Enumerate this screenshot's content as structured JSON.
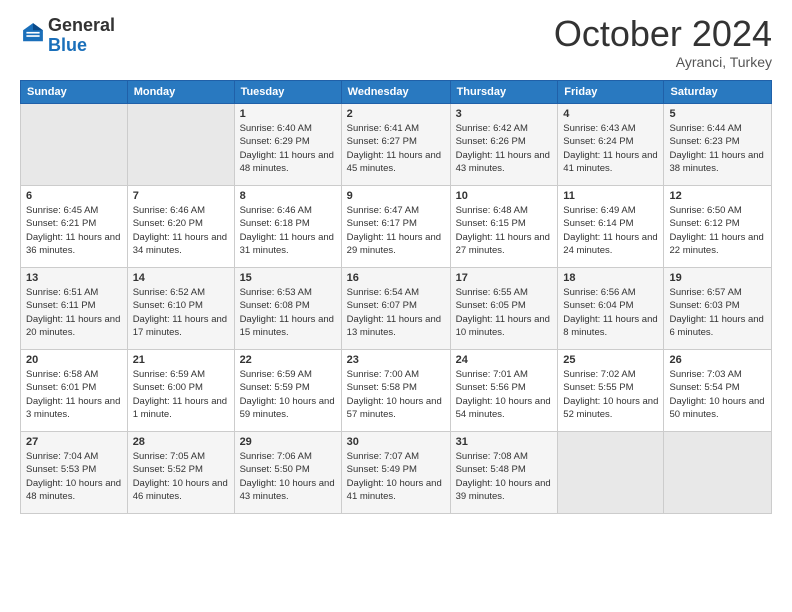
{
  "logo": {
    "general": "General",
    "blue": "Blue"
  },
  "title": {
    "month": "October 2024",
    "location": "Ayranci, Turkey"
  },
  "days_of_week": [
    "Sunday",
    "Monday",
    "Tuesday",
    "Wednesday",
    "Thursday",
    "Friday",
    "Saturday"
  ],
  "weeks": [
    [
      {
        "day": "",
        "detail": ""
      },
      {
        "day": "",
        "detail": ""
      },
      {
        "day": "1",
        "detail": "Sunrise: 6:40 AM\nSunset: 6:29 PM\nDaylight: 11 hours and 48 minutes."
      },
      {
        "day": "2",
        "detail": "Sunrise: 6:41 AM\nSunset: 6:27 PM\nDaylight: 11 hours and 45 minutes."
      },
      {
        "day": "3",
        "detail": "Sunrise: 6:42 AM\nSunset: 6:26 PM\nDaylight: 11 hours and 43 minutes."
      },
      {
        "day": "4",
        "detail": "Sunrise: 6:43 AM\nSunset: 6:24 PM\nDaylight: 11 hours and 41 minutes."
      },
      {
        "day": "5",
        "detail": "Sunrise: 6:44 AM\nSunset: 6:23 PM\nDaylight: 11 hours and 38 minutes."
      }
    ],
    [
      {
        "day": "6",
        "detail": "Sunrise: 6:45 AM\nSunset: 6:21 PM\nDaylight: 11 hours and 36 minutes."
      },
      {
        "day": "7",
        "detail": "Sunrise: 6:46 AM\nSunset: 6:20 PM\nDaylight: 11 hours and 34 minutes."
      },
      {
        "day": "8",
        "detail": "Sunrise: 6:46 AM\nSunset: 6:18 PM\nDaylight: 11 hours and 31 minutes."
      },
      {
        "day": "9",
        "detail": "Sunrise: 6:47 AM\nSunset: 6:17 PM\nDaylight: 11 hours and 29 minutes."
      },
      {
        "day": "10",
        "detail": "Sunrise: 6:48 AM\nSunset: 6:15 PM\nDaylight: 11 hours and 27 minutes."
      },
      {
        "day": "11",
        "detail": "Sunrise: 6:49 AM\nSunset: 6:14 PM\nDaylight: 11 hours and 24 minutes."
      },
      {
        "day": "12",
        "detail": "Sunrise: 6:50 AM\nSunset: 6:12 PM\nDaylight: 11 hours and 22 minutes."
      }
    ],
    [
      {
        "day": "13",
        "detail": "Sunrise: 6:51 AM\nSunset: 6:11 PM\nDaylight: 11 hours and 20 minutes."
      },
      {
        "day": "14",
        "detail": "Sunrise: 6:52 AM\nSunset: 6:10 PM\nDaylight: 11 hours and 17 minutes."
      },
      {
        "day": "15",
        "detail": "Sunrise: 6:53 AM\nSunset: 6:08 PM\nDaylight: 11 hours and 15 minutes."
      },
      {
        "day": "16",
        "detail": "Sunrise: 6:54 AM\nSunset: 6:07 PM\nDaylight: 11 hours and 13 minutes."
      },
      {
        "day": "17",
        "detail": "Sunrise: 6:55 AM\nSunset: 6:05 PM\nDaylight: 11 hours and 10 minutes."
      },
      {
        "day": "18",
        "detail": "Sunrise: 6:56 AM\nSunset: 6:04 PM\nDaylight: 11 hours and 8 minutes."
      },
      {
        "day": "19",
        "detail": "Sunrise: 6:57 AM\nSunset: 6:03 PM\nDaylight: 11 hours and 6 minutes."
      }
    ],
    [
      {
        "day": "20",
        "detail": "Sunrise: 6:58 AM\nSunset: 6:01 PM\nDaylight: 11 hours and 3 minutes."
      },
      {
        "day": "21",
        "detail": "Sunrise: 6:59 AM\nSunset: 6:00 PM\nDaylight: 11 hours and 1 minute."
      },
      {
        "day": "22",
        "detail": "Sunrise: 6:59 AM\nSunset: 5:59 PM\nDaylight: 10 hours and 59 minutes."
      },
      {
        "day": "23",
        "detail": "Sunrise: 7:00 AM\nSunset: 5:58 PM\nDaylight: 10 hours and 57 minutes."
      },
      {
        "day": "24",
        "detail": "Sunrise: 7:01 AM\nSunset: 5:56 PM\nDaylight: 10 hours and 54 minutes."
      },
      {
        "day": "25",
        "detail": "Sunrise: 7:02 AM\nSunset: 5:55 PM\nDaylight: 10 hours and 52 minutes."
      },
      {
        "day": "26",
        "detail": "Sunrise: 7:03 AM\nSunset: 5:54 PM\nDaylight: 10 hours and 50 minutes."
      }
    ],
    [
      {
        "day": "27",
        "detail": "Sunrise: 7:04 AM\nSunset: 5:53 PM\nDaylight: 10 hours and 48 minutes."
      },
      {
        "day": "28",
        "detail": "Sunrise: 7:05 AM\nSunset: 5:52 PM\nDaylight: 10 hours and 46 minutes."
      },
      {
        "day": "29",
        "detail": "Sunrise: 7:06 AM\nSunset: 5:50 PM\nDaylight: 10 hours and 43 minutes."
      },
      {
        "day": "30",
        "detail": "Sunrise: 7:07 AM\nSunset: 5:49 PM\nDaylight: 10 hours and 41 minutes."
      },
      {
        "day": "31",
        "detail": "Sunrise: 7:08 AM\nSunset: 5:48 PM\nDaylight: 10 hours and 39 minutes."
      },
      {
        "day": "",
        "detail": ""
      },
      {
        "day": "",
        "detail": ""
      }
    ]
  ]
}
